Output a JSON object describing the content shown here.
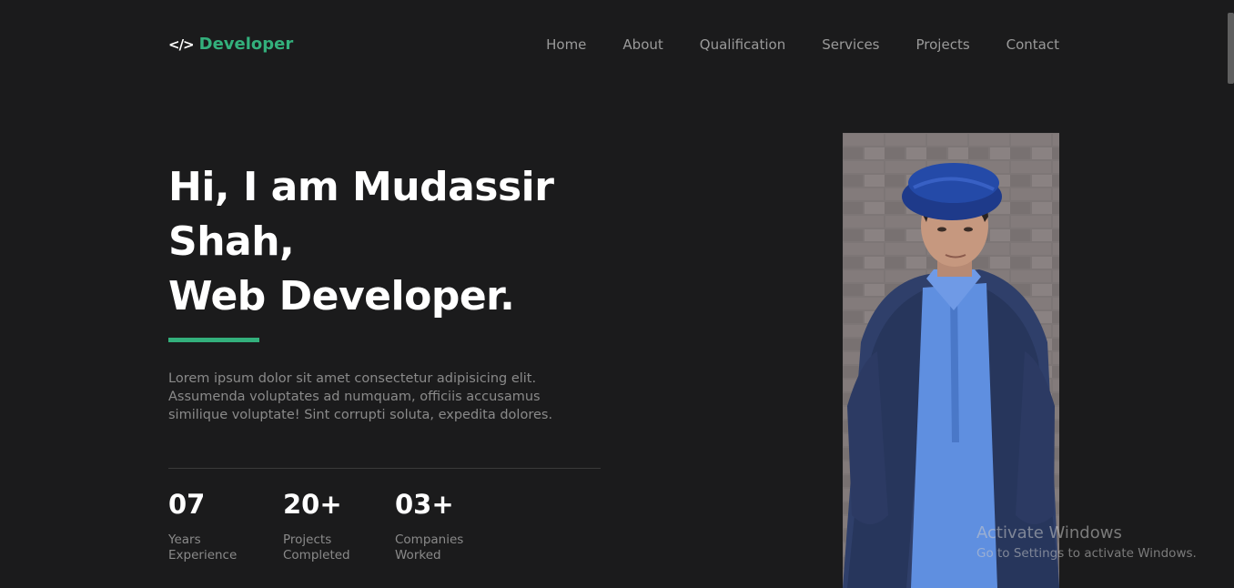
{
  "header": {
    "logo_icon": "</>",
    "logo_text": "Developer",
    "nav": [
      "Home",
      "About",
      "Qualification",
      "Services",
      "Projects",
      "Contact"
    ]
  },
  "hero": {
    "title_lines": [
      "Hi, I am Mudassir",
      "Shah,",
      "Web Developer."
    ],
    "description": "Lorem ipsum dolor sit amet consectetur adipisicing elit. Assumenda voluptates ad numquam, officiis accusamus similique voluptate! Sint corrupti soluta, expedita dolores.",
    "stats": [
      {
        "value": "07",
        "label": "Years Experience"
      },
      {
        "value": "20+",
        "label": "Projects Completed"
      },
      {
        "value": "03+",
        "label": "Companies Worked"
      }
    ]
  },
  "watermark": {
    "title": "Activate Windows",
    "subtitle": "Go to Settings to activate Windows."
  },
  "colors": {
    "background": "#1b1b1c",
    "accent": "#33b07c",
    "heading": "#ffffff",
    "muted": "#8a8a8a"
  },
  "icons": {
    "logo": "code-icon"
  }
}
